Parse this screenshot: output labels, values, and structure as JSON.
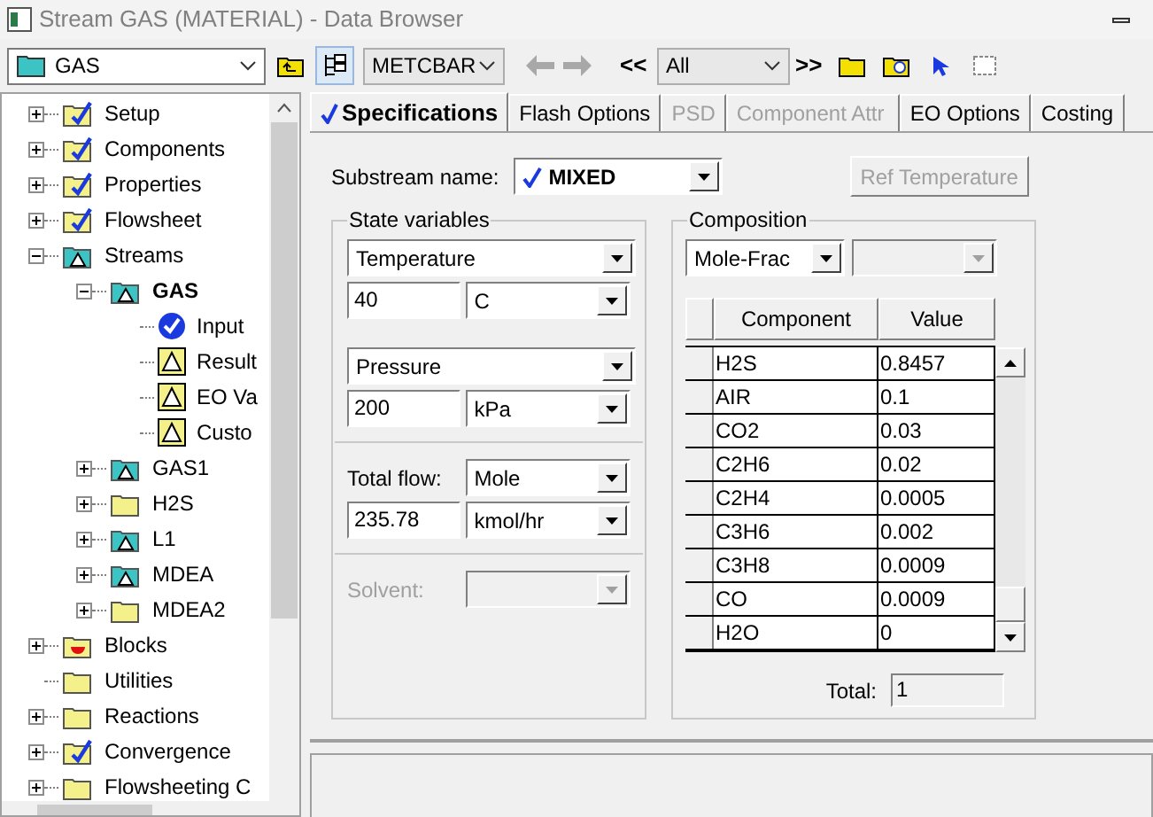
{
  "window": {
    "title": "Stream GAS (MATERIAL) - Data Browser"
  },
  "toolbar": {
    "object_combo": "GAS",
    "units_combo": "METCBAR",
    "back_button": "<<",
    "filter_combo": "All",
    "forward_button": ">>"
  },
  "tree": [
    {
      "label": "Setup",
      "kind": "check-folder",
      "expanded": false,
      "selected": false
    },
    {
      "label": "Components",
      "kind": "check-folder",
      "expanded": false,
      "selected": false
    },
    {
      "label": "Properties",
      "kind": "check-folder",
      "expanded": false,
      "selected": false
    },
    {
      "label": "Flowsheet",
      "kind": "check-folder",
      "expanded": false,
      "selected": false
    },
    {
      "label": "Streams",
      "kind": "warning-folder",
      "expanded": true,
      "selected": false,
      "children": [
        {
          "label": "GAS",
          "kind": "warning-folder",
          "expanded": true,
          "selected": true,
          "children": [
            {
              "label": "Input",
              "kind": "check-circle",
              "selected": false
            },
            {
              "label": "Result",
              "kind": "warning",
              "selected": false
            },
            {
              "label": "EO Va",
              "kind": "warning",
              "selected": false
            },
            {
              "label": "Custo",
              "kind": "warning",
              "selected": false
            }
          ]
        },
        {
          "label": "GAS1",
          "kind": "warning-folder",
          "expanded": false,
          "selected": false
        },
        {
          "label": "H2S",
          "kind": "folder",
          "expanded": false,
          "selected": false
        },
        {
          "label": "L1",
          "kind": "warning-folder",
          "expanded": false,
          "selected": false
        },
        {
          "label": "MDEA",
          "kind": "warning-folder",
          "expanded": false,
          "selected": false
        },
        {
          "label": "MDEA2",
          "kind": "folder",
          "expanded": false,
          "selected": false
        }
      ]
    },
    {
      "label": "Blocks",
      "kind": "block-folder",
      "expanded": false,
      "selected": false
    },
    {
      "label": "Utilities",
      "kind": "folder",
      "selected": false
    },
    {
      "label": "Reactions",
      "kind": "folder",
      "expanded": false,
      "selected": false
    },
    {
      "label": "Convergence",
      "kind": "check-folder",
      "expanded": false,
      "selected": false
    },
    {
      "label": "Flowsheeting C",
      "kind": "folder",
      "expanded": false,
      "selected": false
    }
  ],
  "tabs": [
    {
      "label": "Specifications",
      "selected": true,
      "complete": true,
      "disabled": false
    },
    {
      "label": "Flash Options",
      "selected": false,
      "complete": false,
      "disabled": false
    },
    {
      "label": "PSD",
      "selected": false,
      "complete": false,
      "disabled": true
    },
    {
      "label": "Component Attr",
      "selected": false,
      "complete": false,
      "disabled": true
    },
    {
      "label": "EO Options",
      "selected": false,
      "complete": false,
      "disabled": false
    },
    {
      "label": "Costing",
      "selected": false,
      "complete": false,
      "disabled": false
    }
  ],
  "substream": {
    "label": "Substream name:",
    "value": "MIXED",
    "complete": true,
    "ref_button": "Ref Temperature",
    "ref_disabled": true
  },
  "state_variables": {
    "title": "State variables",
    "rows": [
      {
        "variable": "Temperature",
        "value": "40",
        "unit": "C"
      },
      {
        "variable": "Pressure",
        "value": "200",
        "unit": "kPa"
      }
    ],
    "flow": {
      "label": "Total flow:",
      "basis": "Mole",
      "value": "235.78",
      "unit": "kmol/hr"
    },
    "solvent": {
      "label": "Solvent:",
      "disabled": true
    }
  },
  "composition": {
    "title": "Composition",
    "basis": "Mole-Frac",
    "columns": [
      "Component",
      "Value"
    ],
    "rows": [
      {
        "component": "H2S",
        "value": "0.8457"
      },
      {
        "component": "AIR",
        "value": "0.1"
      },
      {
        "component": "CO2",
        "value": "0.03"
      },
      {
        "component": "C2H6",
        "value": "0.02"
      },
      {
        "component": "C2H4",
        "value": "0.0005"
      },
      {
        "component": "C3H6",
        "value": "0.002"
      },
      {
        "component": "C3H8",
        "value": "0.0009"
      },
      {
        "component": "CO",
        "value": "0.0009"
      },
      {
        "component": "H2O",
        "value": "0"
      }
    ],
    "total_label": "Total:",
    "total": "1"
  }
}
